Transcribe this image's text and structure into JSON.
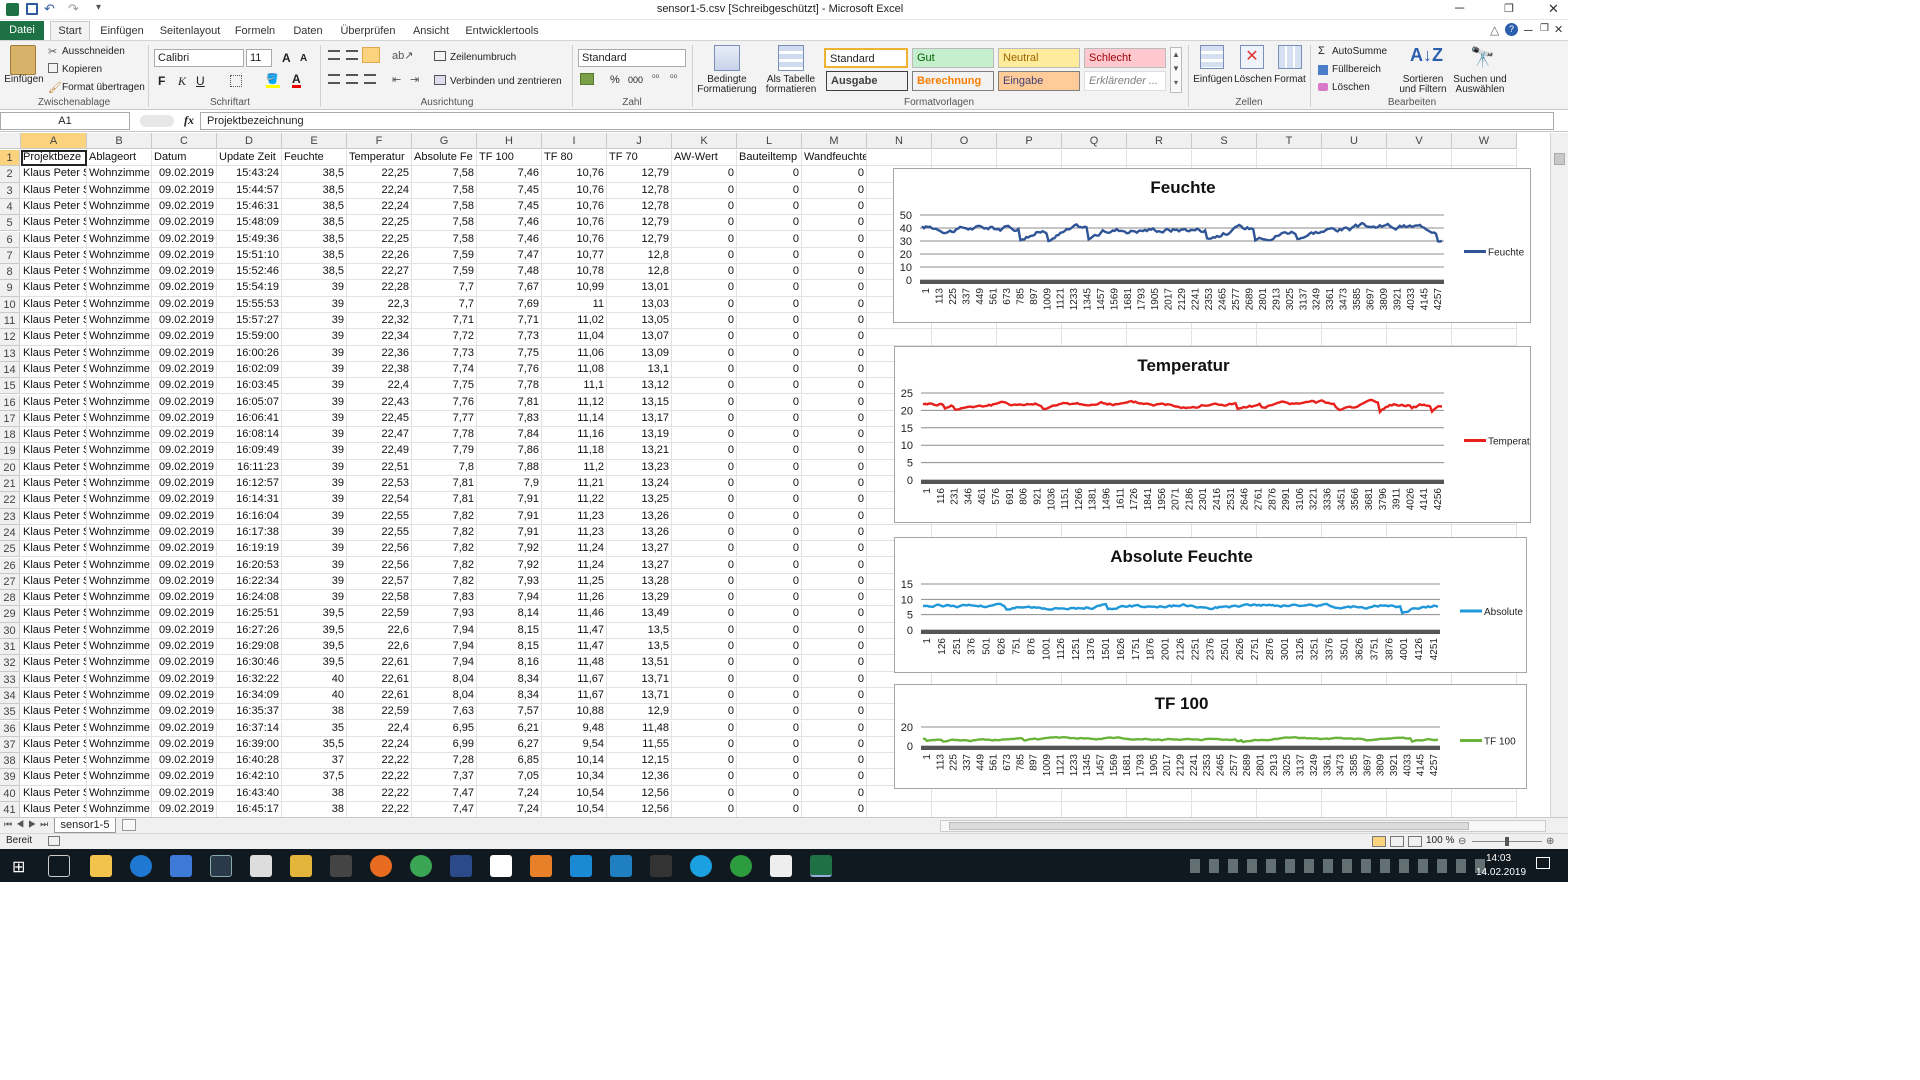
{
  "window": {
    "title": "sensor1-5.csv  [Schreibgeschützt]  -  Microsoft Excel"
  },
  "tabs": [
    "Datei",
    "Start",
    "Einfügen",
    "Seitenlayout",
    "Formeln",
    "Daten",
    "Überprüfen",
    "Ansicht",
    "Entwicklertools"
  ],
  "ribbon": {
    "clipboard": {
      "paste": "Einfügen",
      "cut": "Ausschneiden",
      "copy": "Kopieren",
      "format_painter": "Format übertragen",
      "label": "Zwischenablage"
    },
    "font": {
      "name": "Calibri",
      "size": "11",
      "bold": "F",
      "italic": "K",
      "underline": "U",
      "label": "Schriftart"
    },
    "alignment": {
      "wrap": "Zeilenumbruch",
      "merge": "Verbinden und zentrieren",
      "label": "Ausrichtung"
    },
    "number": {
      "format": "Standard",
      "percent": "%",
      "thousands": "000",
      "label": "Zahl"
    },
    "cond_format": "Bedingte Formatierung",
    "as_table": "Als Tabelle formatieren",
    "styles": {
      "standard": "Standard",
      "gut": "Gut",
      "neutral": "Neutral",
      "schlecht": "Schlecht",
      "ausgabe": "Ausgabe",
      "berechnung": "Berechnung",
      "eingabe": "Eingabe",
      "erklaerend": "Erklärender ...",
      "label": "Formatvorlagen"
    },
    "cells": {
      "insert": "Einfügen",
      "delete": "Löschen",
      "format": "Format",
      "label": "Zellen"
    },
    "editing": {
      "autosum": "AutoSumme",
      "fill": "Füllbereich",
      "clear": "Löschen",
      "sort": "Sortieren und Filtern",
      "find": "Suchen und Auswählen",
      "label": "Bearbeiten"
    }
  },
  "formula_bar": {
    "name_box": "A1",
    "fx": "fx",
    "content": "Projektbezeichnung"
  },
  "columns": [
    "A",
    "B",
    "C",
    "D",
    "E",
    "F",
    "G",
    "H",
    "I",
    "J",
    "K",
    "L",
    "M",
    "N",
    "O",
    "P",
    "Q",
    "R",
    "S",
    "T",
    "U",
    "V",
    "W"
  ],
  "headers": [
    "Projektbeze",
    "Ablageort",
    "Datum",
    "Update Zeit",
    "Feuchte",
    "Temperatur",
    "Absolute Fe",
    "TF 100",
    "TF 80",
    "TF 70",
    "AW-Wert",
    "Bauteiltemp",
    "Wandfeuchte"
  ],
  "rows": [
    [
      "Klaus Peter S",
      "Wohnzimme",
      "09.02.2019",
      "15:43:24",
      "38,5",
      "22,25",
      "7,58",
      "7,46",
      "10,76",
      "12,79",
      "0",
      "0",
      "0"
    ],
    [
      "Klaus Peter S",
      "Wohnzimme",
      "09.02.2019",
      "15:44:57",
      "38,5",
      "22,24",
      "7,58",
      "7,45",
      "10,76",
      "12,78",
      "0",
      "0",
      "0"
    ],
    [
      "Klaus Peter S",
      "Wohnzimme",
      "09.02.2019",
      "15:46:31",
      "38,5",
      "22,24",
      "7,58",
      "7,45",
      "10,76",
      "12,78",
      "0",
      "0",
      "0"
    ],
    [
      "Klaus Peter S",
      "Wohnzimme",
      "09.02.2019",
      "15:48:09",
      "38,5",
      "22,25",
      "7,58",
      "7,46",
      "10,76",
      "12,79",
      "0",
      "0",
      "0"
    ],
    [
      "Klaus Peter S",
      "Wohnzimme",
      "09.02.2019",
      "15:49:36",
      "38,5",
      "22,25",
      "7,58",
      "7,46",
      "10,76",
      "12,79",
      "0",
      "0",
      "0"
    ],
    [
      "Klaus Peter S",
      "Wohnzimme",
      "09.02.2019",
      "15:51:10",
      "38,5",
      "22,26",
      "7,59",
      "7,47",
      "10,77",
      "12,8",
      "0",
      "0",
      "0"
    ],
    [
      "Klaus Peter S",
      "Wohnzimme",
      "09.02.2019",
      "15:52:46",
      "38,5",
      "22,27",
      "7,59",
      "7,48",
      "10,78",
      "12,8",
      "0",
      "0",
      "0"
    ],
    [
      "Klaus Peter S",
      "Wohnzimme",
      "09.02.2019",
      "15:54:19",
      "39",
      "22,28",
      "7,7",
      "7,67",
      "10,99",
      "13,01",
      "0",
      "0",
      "0"
    ],
    [
      "Klaus Peter S",
      "Wohnzimme",
      "09.02.2019",
      "15:55:53",
      "39",
      "22,3",
      "7,7",
      "7,69",
      "11",
      "13,03",
      "0",
      "0",
      "0"
    ],
    [
      "Klaus Peter S",
      "Wohnzimme",
      "09.02.2019",
      "15:57:27",
      "39",
      "22,32",
      "7,71",
      "7,71",
      "11,02",
      "13,05",
      "0",
      "0",
      "0"
    ],
    [
      "Klaus Peter S",
      "Wohnzimme",
      "09.02.2019",
      "15:59:00",
      "39",
      "22,34",
      "7,72",
      "7,73",
      "11,04",
      "13,07",
      "0",
      "0",
      "0"
    ],
    [
      "Klaus Peter S",
      "Wohnzimme",
      "09.02.2019",
      "16:00:26",
      "39",
      "22,36",
      "7,73",
      "7,75",
      "11,06",
      "13,09",
      "0",
      "0",
      "0"
    ],
    [
      "Klaus Peter S",
      "Wohnzimme",
      "09.02.2019",
      "16:02:09",
      "39",
      "22,38",
      "7,74",
      "7,76",
      "11,08",
      "13,1",
      "0",
      "0",
      "0"
    ],
    [
      "Klaus Peter S",
      "Wohnzimme",
      "09.02.2019",
      "16:03:45",
      "39",
      "22,4",
      "7,75",
      "7,78",
      "11,1",
      "13,12",
      "0",
      "0",
      "0"
    ],
    [
      "Klaus Peter S",
      "Wohnzimme",
      "09.02.2019",
      "16:05:07",
      "39",
      "22,43",
      "7,76",
      "7,81",
      "11,12",
      "13,15",
      "0",
      "0",
      "0"
    ],
    [
      "Klaus Peter S",
      "Wohnzimme",
      "09.02.2019",
      "16:06:41",
      "39",
      "22,45",
      "7,77",
      "7,83",
      "11,14",
      "13,17",
      "0",
      "0",
      "0"
    ],
    [
      "Klaus Peter S",
      "Wohnzimme",
      "09.02.2019",
      "16:08:14",
      "39",
      "22,47",
      "7,78",
      "7,84",
      "11,16",
      "13,19",
      "0",
      "0",
      "0"
    ],
    [
      "Klaus Peter S",
      "Wohnzimme",
      "09.02.2019",
      "16:09:49",
      "39",
      "22,49",
      "7,79",
      "7,86",
      "11,18",
      "13,21",
      "0",
      "0",
      "0"
    ],
    [
      "Klaus Peter S",
      "Wohnzimme",
      "09.02.2019",
      "16:11:23",
      "39",
      "22,51",
      "7,8",
      "7,88",
      "11,2",
      "13,23",
      "0",
      "0",
      "0"
    ],
    [
      "Klaus Peter S",
      "Wohnzimme",
      "09.02.2019",
      "16:12:57",
      "39",
      "22,53",
      "7,81",
      "7,9",
      "11,21",
      "13,24",
      "0",
      "0",
      "0"
    ],
    [
      "Klaus Peter S",
      "Wohnzimme",
      "09.02.2019",
      "16:14:31",
      "39",
      "22,54",
      "7,81",
      "7,91",
      "11,22",
      "13,25",
      "0",
      "0",
      "0"
    ],
    [
      "Klaus Peter S",
      "Wohnzimme",
      "09.02.2019",
      "16:16:04",
      "39",
      "22,55",
      "7,82",
      "7,91",
      "11,23",
      "13,26",
      "0",
      "0",
      "0"
    ],
    [
      "Klaus Peter S",
      "Wohnzimme",
      "09.02.2019",
      "16:17:38",
      "39",
      "22,55",
      "7,82",
      "7,91",
      "11,23",
      "13,26",
      "0",
      "0",
      "0"
    ],
    [
      "Klaus Peter S",
      "Wohnzimme",
      "09.02.2019",
      "16:19:19",
      "39",
      "22,56",
      "7,82",
      "7,92",
      "11,24",
      "13,27",
      "0",
      "0",
      "0"
    ],
    [
      "Klaus Peter S",
      "Wohnzimme",
      "09.02.2019",
      "16:20:53",
      "39",
      "22,56",
      "7,82",
      "7,92",
      "11,24",
      "13,27",
      "0",
      "0",
      "0"
    ],
    [
      "Klaus Peter S",
      "Wohnzimme",
      "09.02.2019",
      "16:22:34",
      "39",
      "22,57",
      "7,82",
      "7,93",
      "11,25",
      "13,28",
      "0",
      "0",
      "0"
    ],
    [
      "Klaus Peter S",
      "Wohnzimme",
      "09.02.2019",
      "16:24:08",
      "39",
      "22,58",
      "7,83",
      "7,94",
      "11,26",
      "13,29",
      "0",
      "0",
      "0"
    ],
    [
      "Klaus Peter S",
      "Wohnzimme",
      "09.02.2019",
      "16:25:51",
      "39,5",
      "22,59",
      "7,93",
      "8,14",
      "11,46",
      "13,49",
      "0",
      "0",
      "0"
    ],
    [
      "Klaus Peter S",
      "Wohnzimme",
      "09.02.2019",
      "16:27:26",
      "39,5",
      "22,6",
      "7,94",
      "8,15",
      "11,47",
      "13,5",
      "0",
      "0",
      "0"
    ],
    [
      "Klaus Peter S",
      "Wohnzimme",
      "09.02.2019",
      "16:29:08",
      "39,5",
      "22,6",
      "7,94",
      "8,15",
      "11,47",
      "13,5",
      "0",
      "0",
      "0"
    ],
    [
      "Klaus Peter S",
      "Wohnzimme",
      "09.02.2019",
      "16:30:46",
      "39,5",
      "22,61",
      "7,94",
      "8,16",
      "11,48",
      "13,51",
      "0",
      "0",
      "0"
    ],
    [
      "Klaus Peter S",
      "Wohnzimme",
      "09.02.2019",
      "16:32:22",
      "40",
      "22,61",
      "8,04",
      "8,34",
      "11,67",
      "13,71",
      "0",
      "0",
      "0"
    ],
    [
      "Klaus Peter S",
      "Wohnzimme",
      "09.02.2019",
      "16:34:09",
      "40",
      "22,61",
      "8,04",
      "8,34",
      "11,67",
      "13,71",
      "0",
      "0",
      "0"
    ],
    [
      "Klaus Peter S",
      "Wohnzimme",
      "09.02.2019",
      "16:35:37",
      "38",
      "22,59",
      "7,63",
      "7,57",
      "10,88",
      "12,9",
      "0",
      "0",
      "0"
    ],
    [
      "Klaus Peter S",
      "Wohnzimme",
      "09.02.2019",
      "16:37:14",
      "35",
      "22,4",
      "6,95",
      "6,21",
      "9,48",
      "11,48",
      "0",
      "0",
      "0"
    ],
    [
      "Klaus Peter S",
      "Wohnzimme",
      "09.02.2019",
      "16:39:00",
      "35,5",
      "22,24",
      "6,99",
      "6,27",
      "9,54",
      "11,55",
      "0",
      "0",
      "0"
    ],
    [
      "Klaus Peter S",
      "Wohnzimme",
      "09.02.2019",
      "16:40:28",
      "37",
      "22,22",
      "7,28",
      "6,85",
      "10,14",
      "12,15",
      "0",
      "0",
      "0"
    ],
    [
      "Klaus Peter S",
      "Wohnzimme",
      "09.02.2019",
      "16:42:10",
      "37,5",
      "22,22",
      "7,37",
      "7,05",
      "10,34",
      "12,36",
      "0",
      "0",
      "0"
    ],
    [
      "Klaus Peter S",
      "Wohnzimme",
      "09.02.2019",
      "16:43:40",
      "38",
      "22,22",
      "7,47",
      "7,24",
      "10,54",
      "12,56",
      "0",
      "0",
      "0"
    ],
    [
      "Klaus Peter S",
      "Wohnzimme",
      "09.02.2019",
      "16:45:17",
      "38",
      "22,22",
      "7,47",
      "7,24",
      "10,54",
      "12,56",
      "0",
      "0",
      "0"
    ]
  ],
  "chart_data": [
    {
      "type": "line",
      "title": "Feuchte",
      "series": [
        {
          "name": "Feuchte",
          "color": "#2f5597",
          "approx_range": [
            29,
            47
          ]
        }
      ],
      "ylim": [
        0,
        50
      ],
      "yticks": [
        "0",
        "10",
        "20",
        "30",
        "40",
        "50"
      ],
      "x": [
        "1",
        "113",
        "225",
        "337",
        "449",
        "561",
        "673",
        "785",
        "897",
        "1009",
        "1121",
        "1233",
        "1345",
        "1457",
        "1569",
        "1681",
        "1793",
        "1905",
        "2017",
        "2129",
        "2241",
        "2353",
        "2465",
        "2577",
        "2689",
        "2801",
        "2913",
        "3025",
        "3137",
        "3249",
        "3361",
        "3473",
        "3585",
        "3697",
        "3809",
        "3921",
        "4033",
        "4145",
        "4257"
      ]
    },
    {
      "type": "line",
      "title": "Temperatur",
      "series": [
        {
          "name": "Temperatur",
          "color": "#e8211d",
          "approx_range": [
            19.5,
            23.5
          ]
        }
      ],
      "ylim": [
        0,
        25
      ],
      "yticks": [
        "0",
        "5",
        "10",
        "15",
        "20",
        "25"
      ],
      "x": [
        "1",
        "116",
        "231",
        "346",
        "461",
        "576",
        "691",
        "806",
        "921",
        "1036",
        "1151",
        "1266",
        "1381",
        "1496",
        "1611",
        "1726",
        "1841",
        "1956",
        "2071",
        "2186",
        "2301",
        "2416",
        "2531",
        "2646",
        "2761",
        "2876",
        "2991",
        "3106",
        "3221",
        "3336",
        "3451",
        "3566",
        "3681",
        "3796",
        "3911",
        "4026",
        "4141",
        "4256"
      ]
    },
    {
      "type": "line",
      "title": "Absolute Feuchte",
      "series": [
        {
          "name": "Absolute Feuchte",
          "color": "#1f97d9",
          "approx_range": [
            5.5,
            9.5
          ]
        }
      ],
      "ylim": [
        0,
        15
      ],
      "yticks": [
        "0",
        "5",
        "10",
        "15"
      ],
      "x": [
        "1",
        "126",
        "251",
        "376",
        "501",
        "626",
        "751",
        "876",
        "1001",
        "1126",
        "1251",
        "1376",
        "1501",
        "1626",
        "1751",
        "1876",
        "2001",
        "2126",
        "2251",
        "2376",
        "2501",
        "2626",
        "2751",
        "2876",
        "3001",
        "3126",
        "3251",
        "3376",
        "3501",
        "3626",
        "3751",
        "3876",
        "4001",
        "4126",
        "4251"
      ]
    },
    {
      "type": "line",
      "title": "TF 100",
      "series": [
        {
          "name": "TF 100",
          "color": "#6ab33a",
          "approx_range": [
            4,
            10
          ]
        }
      ],
      "ylim": [
        0,
        20
      ],
      "yticks": [
        "0",
        "20"
      ],
      "x": [
        "1",
        "113",
        "225",
        "337",
        "449",
        "561",
        "673",
        "785",
        "897",
        "1009",
        "1121",
        "1233",
        "1345",
        "1457",
        "1569",
        "1681",
        "1793",
        "1905",
        "2017",
        "2129",
        "2241",
        "2353",
        "2465",
        "2577",
        "2689",
        "2801",
        "2913",
        "3025",
        "3137",
        "3249",
        "3361",
        "3473",
        "3585",
        "3697",
        "3809",
        "3921",
        "4033",
        "4145",
        "4257"
      ]
    }
  ],
  "sheet_tab": "sensor1-5",
  "status": {
    "ready": "Bereit",
    "zoom": "100 %"
  },
  "clock": {
    "time": "14:03",
    "date": "14.02.2019"
  }
}
